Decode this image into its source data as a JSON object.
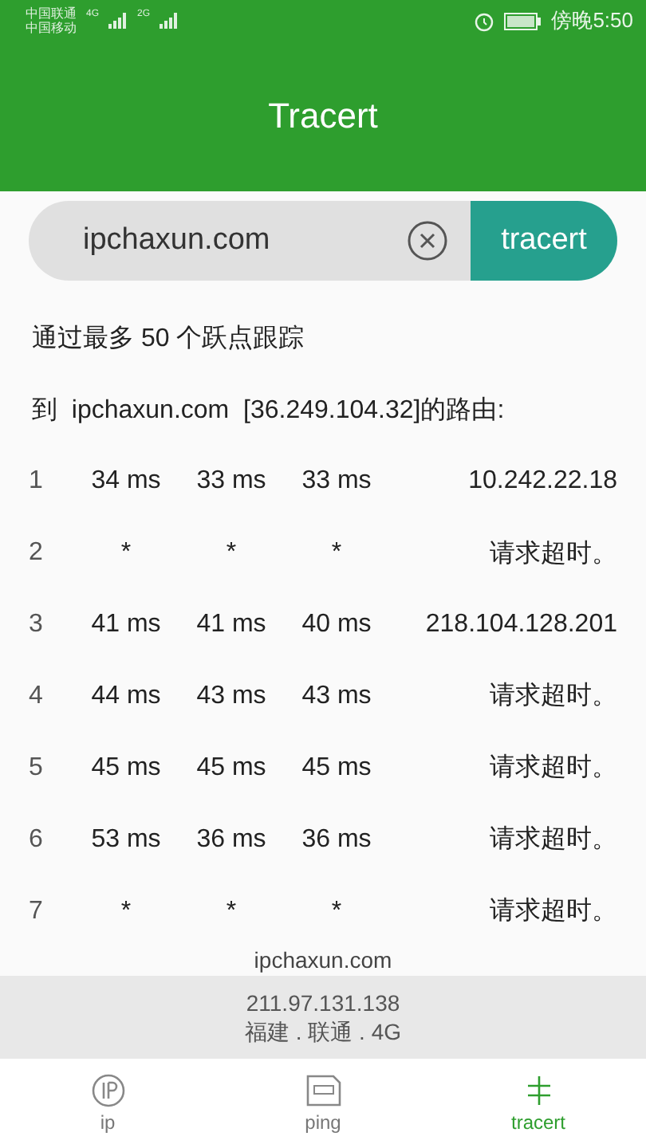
{
  "status_bar": {
    "carriers": [
      "中国联通",
      "中国移动"
    ],
    "networks": [
      "4G",
      "2G"
    ],
    "time": "傍晚5:50"
  },
  "header": {
    "title": "Tracert"
  },
  "search": {
    "value": "ipchaxun.com",
    "button": "tracert"
  },
  "info": [
    "通过最多 50 个跃点跟踪",
    "到  ipchaxun.com  [36.249.104.32]的路由:"
  ],
  "hops": [
    {
      "hop": "1",
      "times": [
        "34 ms",
        "33 ms",
        "33 ms"
      ],
      "address": "10.242.22.18"
    },
    {
      "hop": "2",
      "times": [
        "*",
        "*",
        "*"
      ],
      "address": "请求超时。"
    },
    {
      "hop": "3",
      "times": [
        "41 ms",
        "41 ms",
        "40 ms"
      ],
      "address": "218.104.128.201"
    },
    {
      "hop": "4",
      "times": [
        "44 ms",
        "43 ms",
        "43 ms"
      ],
      "address": "请求超时。"
    },
    {
      "hop": "5",
      "times": [
        "45 ms",
        "45 ms",
        "45 ms"
      ],
      "address": "请求超时。"
    },
    {
      "hop": "6",
      "times": [
        "53 ms",
        "36 ms",
        "36 ms"
      ],
      "address": "请求超时。"
    },
    {
      "hop": "7",
      "times": [
        "*",
        "*",
        "*"
      ],
      "address": "请求超时。"
    }
  ],
  "site": "ipchaxun.com",
  "footer": {
    "ip": "211.97.131.138",
    "location": "福建 . 联通 . 4G"
  },
  "tabs": [
    {
      "kind": "ip",
      "label": "ip",
      "selected": false
    },
    {
      "kind": "ping",
      "label": "ping",
      "selected": false
    },
    {
      "kind": "tracert",
      "label": "tracert",
      "selected": true
    }
  ]
}
